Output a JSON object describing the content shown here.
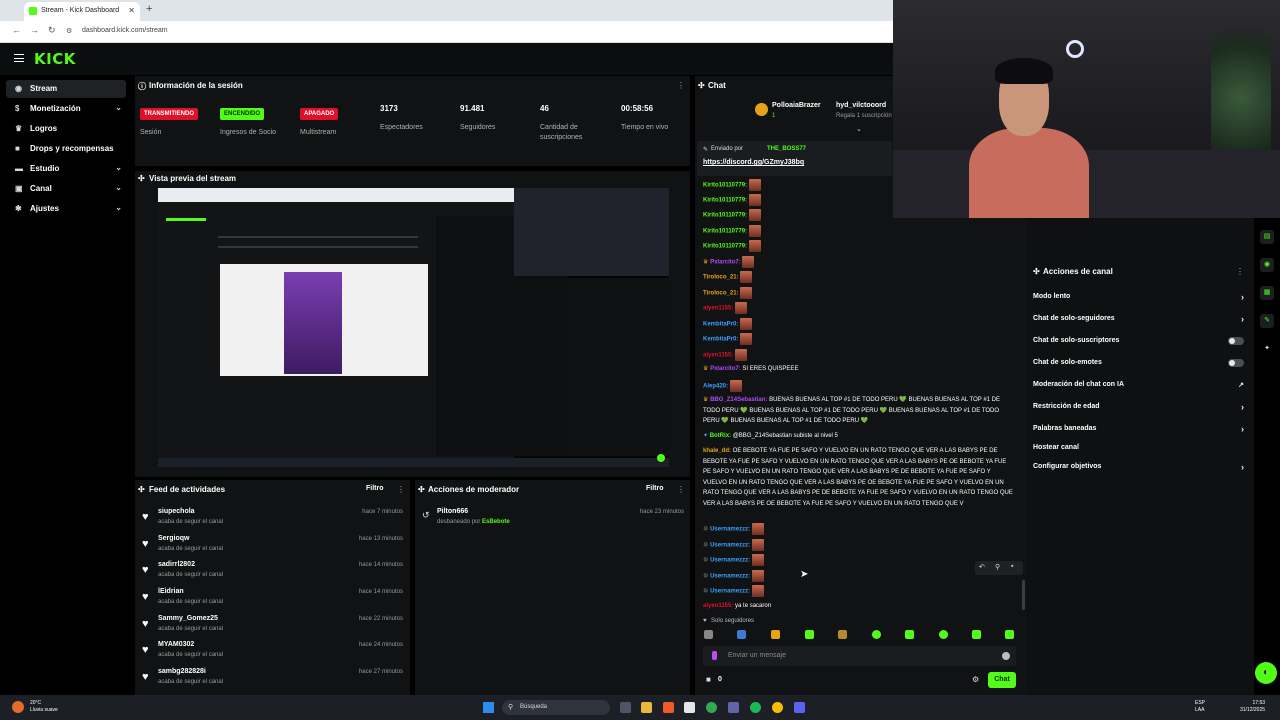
{
  "browser": {
    "tab_title": "Stream - Kick Dashboard",
    "url": "dashboard.kick.com/stream"
  },
  "header": {
    "logo": "KICK"
  },
  "sidebar": {
    "items": [
      {
        "label": "Stream",
        "icon": "broadcast-icon"
      },
      {
        "label": "Monetización",
        "icon": "money-icon"
      },
      {
        "label": "Logros",
        "icon": "trophy-icon"
      },
      {
        "label": "Drops y recompensas",
        "icon": "gift-icon"
      },
      {
        "label": "Estudio",
        "icon": "studio-icon"
      },
      {
        "label": "Canal",
        "icon": "channel-icon"
      },
      {
        "label": "Ajustes",
        "icon": "gear-icon"
      }
    ]
  },
  "session": {
    "title": "Información de la sesión",
    "stats": [
      {
        "badge": "TRANSMITIENDO",
        "label": "Sesión"
      },
      {
        "badge": "ENCENDIDO",
        "label": "Ingresos de Socio"
      },
      {
        "badge": "APAGADO",
        "label": "Multistream"
      },
      {
        "value": "3173",
        "label": "Espectadores"
      },
      {
        "value": "91.481",
        "label": "Seguidores"
      },
      {
        "value": "46",
        "label": "Cantidad de suscripciones"
      },
      {
        "value": "00:58:56",
        "label": "Tiempo en vivo"
      }
    ]
  },
  "preview": {
    "title": "Vista previa del stream"
  },
  "feed": {
    "title": "Feed de actividades",
    "filter": "Filtro",
    "items": [
      {
        "name": "siupechola",
        "sub": "acaba de seguir el canal",
        "time": "hace 7 minutos"
      },
      {
        "name": "Sergioqw",
        "sub": "acaba de seguir el canal",
        "time": "hace 13 minutos"
      },
      {
        "name": "sadirrl2802",
        "sub": "acaba de seguir el canal",
        "time": "hace 14 minutos"
      },
      {
        "name": "lEidrian",
        "sub": "acaba de seguir el canal",
        "time": "hace 14 minutos"
      },
      {
        "name": "Sammy_Gomez25",
        "sub": "acaba de seguir el canal",
        "time": "hace 22 minutos"
      },
      {
        "name": "MYAM0302",
        "sub": "acaba de seguir el canal",
        "time": "hace 24 minutos"
      },
      {
        "name": "sambg282828i",
        "sub": "acaba de seguir el canal",
        "time": "hace 27 minutos"
      }
    ]
  },
  "mod": {
    "title": "Acciones de moderador",
    "filter": "Filtro",
    "item_name": "Pilton666",
    "item_sub_prefix": "desbaneado por ",
    "item_by": "EsBebote",
    "item_time": "hace 23 minutos"
  },
  "chat": {
    "title": "Chat",
    "top_user": "PolloaiaBrazer",
    "top_user2": "hyd_vilctooord",
    "top_sub": "Regala 1 suscripción",
    "top_count": "1",
    "pin_prefix": "Enviado por",
    "pin_user": "THE_BOSS77",
    "pin_link": "https://discord.gg/GZmyJ38bq",
    "messages": [
      {
        "user": "Kirito10110779:",
        "color": "#53fc18",
        "text": "",
        "emote": true
      },
      {
        "user": "Kirito10110779:",
        "color": "#53fc18",
        "text": "",
        "emote": true
      },
      {
        "user": "Kirito10110779:",
        "color": "#53fc18",
        "text": "",
        "emote": true
      },
      {
        "user": "Kirito10110779:",
        "color": "#53fc18",
        "text": "",
        "emote": true
      },
      {
        "user": "Kirito10110779:",
        "color": "#53fc18",
        "text": "",
        "emote": true
      },
      {
        "user": "Pxlarcito7:",
        "color": "#b54af5",
        "text": "",
        "emote": true
      },
      {
        "user": "Tiroloco_21:",
        "color": "#e6a317",
        "text": "",
        "emote": true
      },
      {
        "user": "Tiroloco_21:",
        "color": "#e6a317",
        "text": "",
        "emote": true
      },
      {
        "user": "alyen1155:",
        "color": "#e0102b",
        "text": "",
        "emote": true
      },
      {
        "user": "KembitaPr0:",
        "color": "#3aa0ff",
        "text": "",
        "emote": true
      },
      {
        "user": "KembitaPr0:",
        "color": "#3aa0ff",
        "text": "",
        "emote": true
      },
      {
        "user": "alyen1155:",
        "color": "#e0102b",
        "text": "",
        "emote": true
      },
      {
        "user": "Pxlarcito7:",
        "color": "#b54af5",
        "text": "SI ERES QUISPEEE",
        "emote": false
      },
      {
        "user": "Alep420:",
        "color": "#3aa0ff",
        "text": "",
        "emote": true
      }
    ],
    "long1_user": "BBG_Z14Sebastian:",
    "long1_text": "BUENAS BUENAS AL TOP #1 DE TODO PERU 💚 BUENAS BUENAS AL TOP #1 DE TODO PERU 💚 BUENAS BUENAS AL TOP #1 DE TODO PERU 💚 BUENAS BUENAS AL TOP #1 DE TODO PERU 💚 BUENAS BUENAS AL TOP #1 DE TODO PERU 💚",
    "bot_user": "BotRix:",
    "bot_text": "@BBG_Z14Sebastian subiste al nivel 5",
    "long2_user": "khale_dd:",
    "long2_text": "OE BEBOTE YA FUE PE SAFO Y VUELVO EN UN RATO TENGO QUE VER A LAS BABYS PE DE BEBOTE YA FUE PE SAFO Y VUELVO EN UN RATO TENGO QUE VER A LAS BABYS PE OE BEBOTE YA FUE PE SAFO Y VUELVO EN UN RATO TENGO QUE VER A LAS BABYS PE DE BEBOTE YA FUE PE SAFO Y VUELVO EN UN RATO TENGO QUE VER A LAS BABYS PE OE BEBOTE YA FUE PE SAFO Y VUELVO EN UN RATO TENGO QUE VER A LAS BABYS PE DE BEBOTE YA FUE PE SAFO Y VUELVO EN UN RATO TENGO QUE VER A LAS BABYS PE OE BEBOTE YA FUE PE SAFO Y VUELVO EN UN RATO TENGO QUE V",
    "user_rows": [
      "Usernamezzz:",
      "Usernamezzz:",
      "Usernamezzz:",
      "Usernamezzz:",
      "Usernamezzz:"
    ],
    "last_user": "alyen1155:",
    "last_text": "ya te sacaron",
    "followers_only": "Solo seguidores",
    "input_placeholder": "Enviar un mensaje",
    "gift_count": "0",
    "send_label": "Chat"
  },
  "channel_actions": {
    "title": "Acciones de canal",
    "items": [
      {
        "label": "Modo lento",
        "kind": "chevron"
      },
      {
        "label": "Chat de solo-seguidores",
        "kind": "chevron"
      },
      {
        "label": "Chat de solo-suscriptores",
        "kind": "toggle"
      },
      {
        "label": "Chat de solo-emotes",
        "kind": "toggle"
      },
      {
        "label": "Moderación del chat con IA",
        "kind": "external"
      },
      {
        "label": "Restricción de edad",
        "kind": "chevron"
      },
      {
        "label": "Palabras baneadas",
        "kind": "chevron"
      },
      {
        "label": "Hostear canal",
        "kind": "none"
      },
      {
        "label": "Configurar objetivos",
        "kind": "chevron"
      }
    ]
  },
  "taskbar": {
    "temp": "20°C",
    "weather": "Lluvia suave",
    "search": "Búsqueda",
    "lang1": "ESP",
    "lang2": "LAA",
    "time": "17:53",
    "date": "31/12/2025"
  },
  "colors": {
    "accent": "#53fc18",
    "live_red": "#e0102b",
    "bg": "#000000",
    "panel": "#101213"
  }
}
